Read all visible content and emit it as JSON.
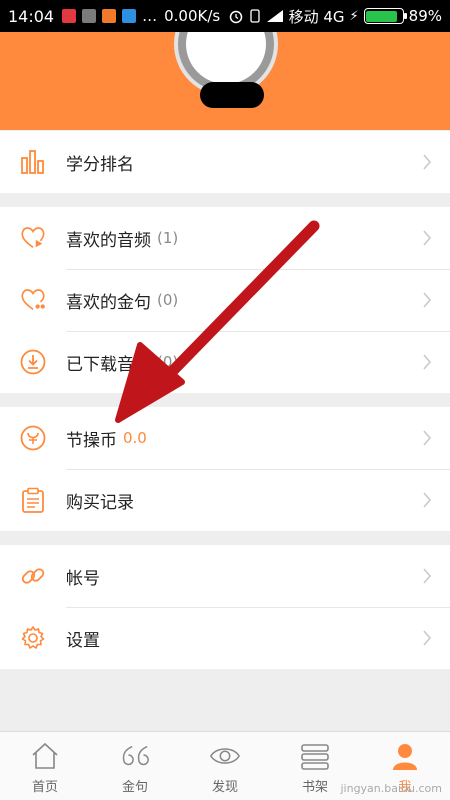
{
  "status_bar": {
    "time": "14:04",
    "network_speed": "0.00K/s",
    "carrier": "移动 4G",
    "battery": "89%",
    "battery_fraction": 0.89
  },
  "list_groups": [
    {
      "items": [
        {
          "id": "rank",
          "label": "学分排名"
        }
      ]
    },
    {
      "items": [
        {
          "id": "fav-audio",
          "label": "喜欢的音频",
          "count": "(1)"
        },
        {
          "id": "fav-quote",
          "label": "喜欢的金句",
          "count": "(0)"
        },
        {
          "id": "downloads",
          "label": "已下载音频",
          "count": "(0)"
        }
      ]
    },
    {
      "items": [
        {
          "id": "coins",
          "label": "节操币",
          "coins": "0.0"
        },
        {
          "id": "purchase",
          "label": "购买记录"
        }
      ]
    },
    {
      "items": [
        {
          "id": "account",
          "label": "帐号"
        },
        {
          "id": "settings",
          "label": "设置"
        }
      ]
    }
  ],
  "bottom_nav": [
    {
      "label": "首页",
      "icon": "home-icon"
    },
    {
      "label": "金句",
      "icon": "quote-icon"
    },
    {
      "label": "发现",
      "icon": "eye-icon"
    },
    {
      "label": "书架",
      "icon": "bookshelf-icon"
    },
    {
      "label": "我",
      "icon": "user-icon",
      "active": true
    }
  ],
  "watermark": "jingyan.baidu.com",
  "colors": {
    "accent": "#ff8a3d",
    "annotation_arrow": "#c0161b"
  }
}
